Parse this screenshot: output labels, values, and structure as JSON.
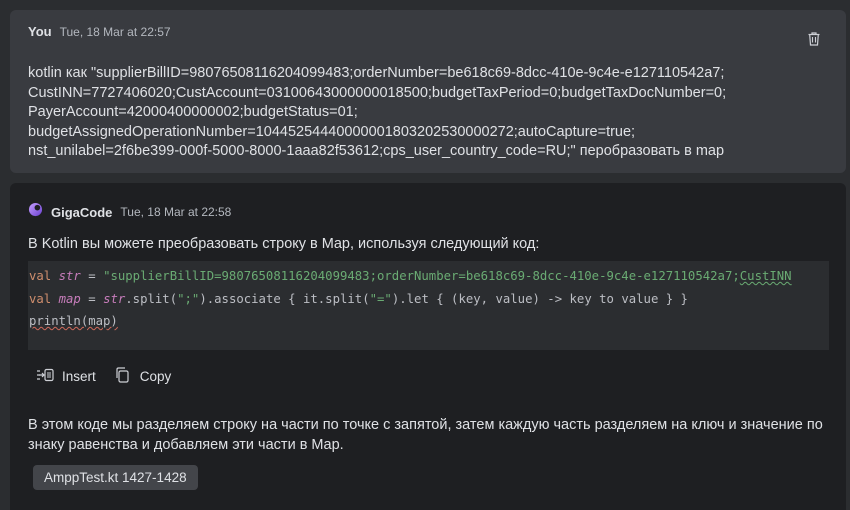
{
  "user_message": {
    "author": "You",
    "timestamp": "Tue, 18 Mar at 22:57",
    "delete_icon": "trash-icon",
    "text": "kotlin как \"supplierBillID=98076508116204099483;orderNumber=be618c69-8dcc-410e-9c4e-e127110542a7;\nCustINN=7727406020;CustAccount=03100643000000018500;budgetTaxPeriod=0;budgetTaxDocNumber=0;\nPayerAccount=42000400000002;budgetStatus=01;\nbudgetAssignedOperationNumber=10445254440000001803202530000272;autoCapture=true;\nnst_unilabel=2f6be399-000f-5000-8000-1aaa82f53612;cps_user_country_code=RU;\" перобразовать в map"
  },
  "assistant_message": {
    "author": "GigaCode",
    "timestamp": "Tue, 18 Mar at 22:58",
    "logo_icon": "gigacode-logo-icon",
    "intro": "В Kotlin вы можете преобразовать строку в Map, используя следующий код:",
    "code": {
      "line1": {
        "kw": "val",
        "name": "str",
        "op": " = ",
        "string_start": "\"supplierBillID=98076508116204099483;orderNumber=be618c69-8dcc-410e-9c4e-e127110542a7;",
        "string_tail": "CustINN"
      },
      "line2": {
        "kw": "val",
        "name": "map",
        "op1": " = ",
        "recv": "str",
        "call1": ".split(",
        "arg1": "\";\"",
        "call2": ").associate { it.split(",
        "arg2": "\"=\"",
        "rest": ").let { (key, value) -> key to value } }"
      },
      "line3": "println(map)"
    },
    "actions": {
      "insert": "Insert",
      "copy": "Copy"
    },
    "explanation": "В этом коде мы разделяем строку на части по точке с запятой, затем каждую часть разделяем на ключ и значение по знаку равенства и добавляем эти части в Map.",
    "file_ref": "AmppTest.kt 1427-1428"
  },
  "colors": {
    "background": "#2b2d30",
    "user_bubble": "#393b40",
    "assistant_bubble": "#1e1f22",
    "keyword": "#cf8e6d",
    "string": "#6aab73",
    "identifier": "#c77dbb"
  }
}
